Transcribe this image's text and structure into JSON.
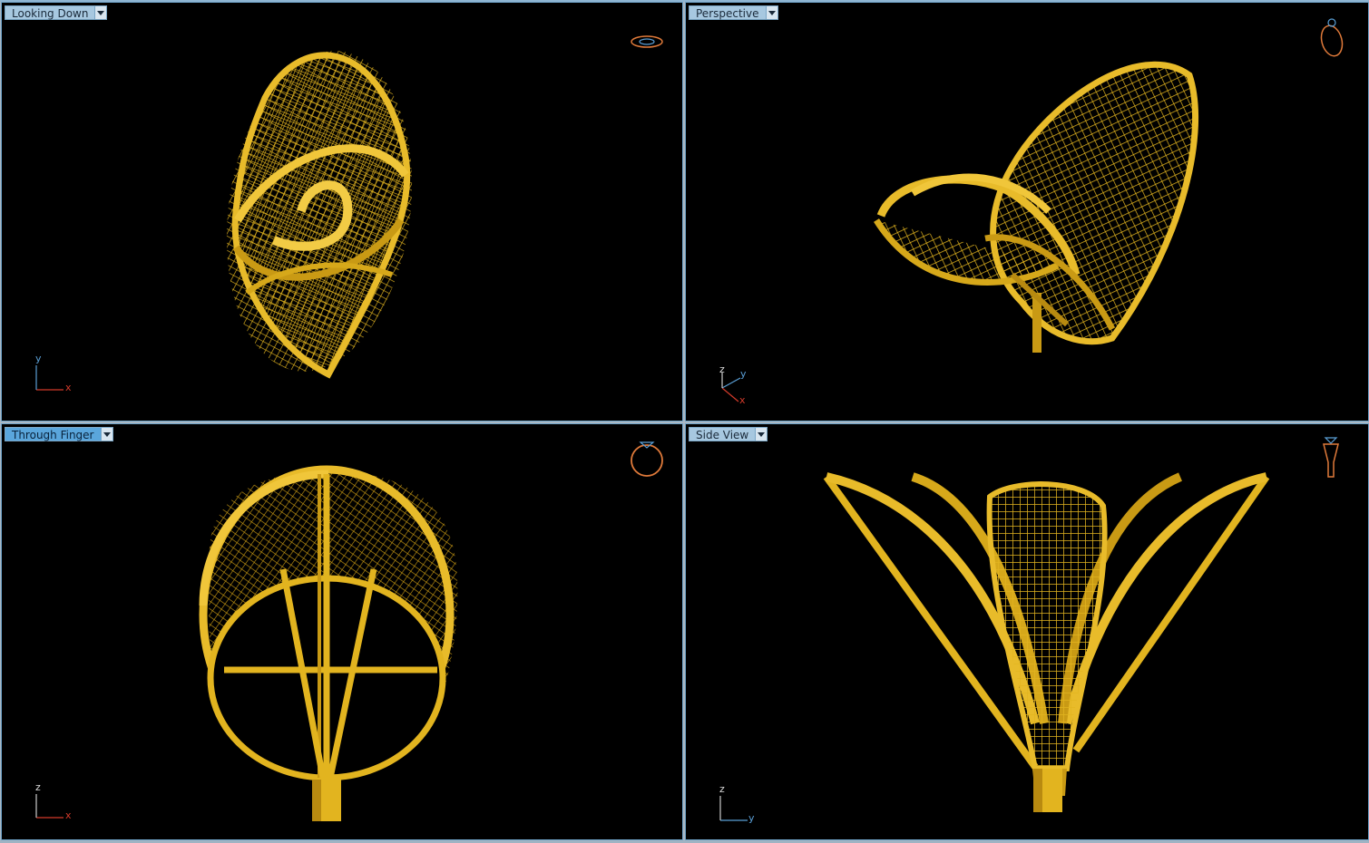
{
  "viewports": [
    {
      "id": "looking-down",
      "label": "Looking Down",
      "active": false,
      "axes": [
        "y",
        "x"
      ]
    },
    {
      "id": "perspective",
      "label": "Perspective",
      "active": false,
      "axes": [
        "z",
        "y",
        "x"
      ]
    },
    {
      "id": "through-finger",
      "label": "Through Finger",
      "active": true,
      "axes": [
        "z",
        "x"
      ]
    },
    {
      "id": "side-view",
      "label": "Side View",
      "active": false,
      "axes": [
        "z",
        "y"
      ]
    }
  ],
  "colors": {
    "viewport_bg": "#000000",
    "gold": "#e2b41f",
    "gold_dark": "#8a6a08",
    "axis_red": "#d23a2a",
    "axis_blue": "#5a9fd6",
    "nav_icon": "#e07a3a"
  }
}
